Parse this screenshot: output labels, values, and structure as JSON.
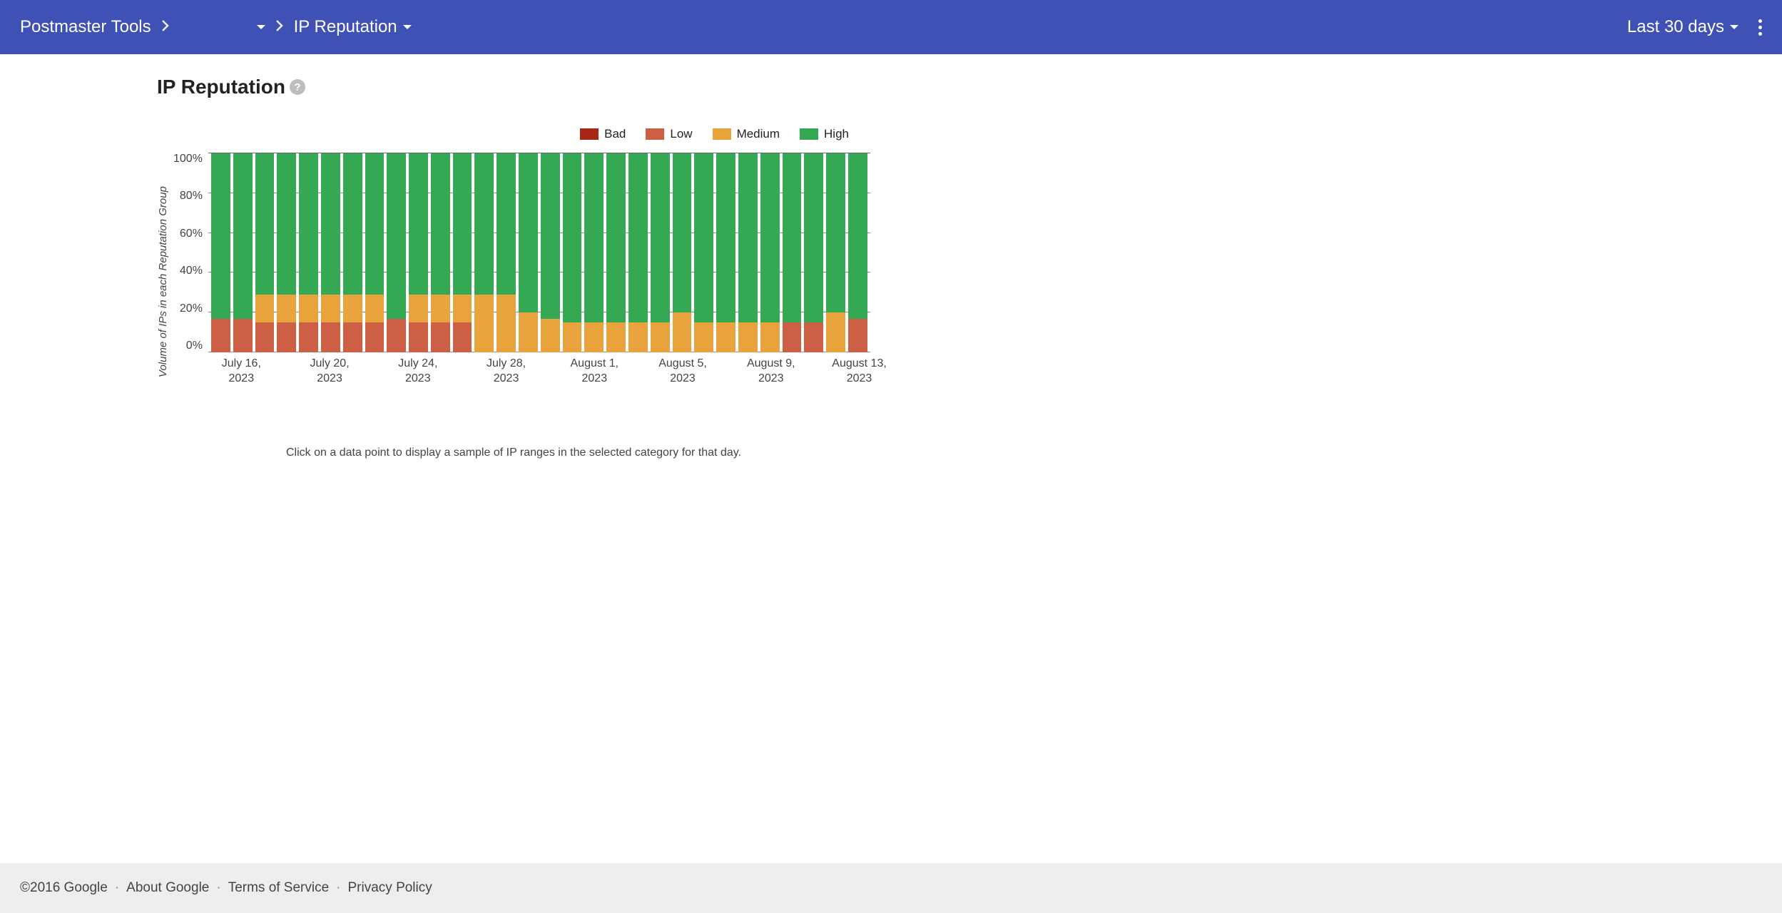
{
  "header": {
    "app_title": "Postmaster Tools",
    "domain_label": "",
    "view_label": "IP Reputation",
    "daterange_label": "Last 30 days"
  },
  "page": {
    "title": "IP Reputation",
    "help_glyph": "?"
  },
  "legend": {
    "bad": {
      "label": "Bad",
      "color": "#a52714"
    },
    "low": {
      "label": "Low",
      "color": "#cc5f44"
    },
    "medium": {
      "label": "Medium",
      "color": "#e8a33d"
    },
    "high": {
      "label": "High",
      "color": "#34a853"
    }
  },
  "chart_data": {
    "type": "stacked-bar",
    "title": "IP Reputation",
    "ylabel": "Volume of IPs in each Reputation Group",
    "xlabel": "",
    "ylim": [
      0,
      100
    ],
    "yticks": [
      "0%",
      "20%",
      "40%",
      "60%",
      "80%",
      "100%"
    ],
    "xtick_labels": [
      "July 16, 2023",
      "July 20, 2023",
      "July 24, 2023",
      "July 28, 2023",
      "August 1, 2023",
      "August 5, 2023",
      "August 9, 2023",
      "August 13, 2023"
    ],
    "xtick_indices": [
      1,
      5,
      9,
      13,
      17,
      21,
      25,
      29
    ],
    "categories": [
      "July 15, 2023",
      "July 16, 2023",
      "July 17, 2023",
      "July 18, 2023",
      "July 19, 2023",
      "July 20, 2023",
      "July 21, 2023",
      "July 22, 2023",
      "July 23, 2023",
      "July 24, 2023",
      "July 25, 2023",
      "July 26, 2023",
      "July 27, 2023",
      "July 28, 2023",
      "July 29, 2023",
      "July 30, 2023",
      "July 31, 2023",
      "August 1, 2023",
      "August 2, 2023",
      "August 3, 2023",
      "August 4, 2023",
      "August 5, 2023",
      "August 6, 2023",
      "August 7, 2023",
      "August 8, 2023",
      "August 9, 2023",
      "August 10, 2023",
      "August 11, 2023",
      "August 12, 2023",
      "August 13, 2023"
    ],
    "series": [
      {
        "name": "Bad",
        "color": "#a52714",
        "values": [
          0,
          0,
          0,
          0,
          0,
          0,
          0,
          0,
          0,
          0,
          0,
          0,
          0,
          0,
          0,
          0,
          0,
          0,
          0,
          0,
          0,
          0,
          0,
          0,
          0,
          0,
          0,
          0,
          0,
          0
        ]
      },
      {
        "name": "Low",
        "color": "#cc5f44",
        "values": [
          17,
          17,
          15,
          15,
          15,
          15,
          15,
          15,
          17,
          15,
          15,
          15,
          0,
          0,
          0,
          0,
          0,
          0,
          0,
          0,
          0,
          0,
          0,
          0,
          0,
          0,
          15,
          15,
          0,
          17
        ]
      },
      {
        "name": "Medium",
        "color": "#e8a33d",
        "values": [
          0,
          0,
          14,
          14,
          14,
          14,
          14,
          14,
          0,
          14,
          14,
          14,
          29,
          29,
          20,
          17,
          15,
          15,
          15,
          15,
          15,
          20,
          15,
          15,
          15,
          15,
          0,
          0,
          20,
          0
        ]
      },
      {
        "name": "High",
        "color": "#34a853",
        "values": [
          83,
          83,
          71,
          71,
          71,
          71,
          71,
          71,
          83,
          71,
          71,
          71,
          71,
          71,
          80,
          83,
          85,
          85,
          85,
          85,
          85,
          80,
          85,
          85,
          85,
          85,
          85,
          85,
          80,
          83
        ]
      }
    ],
    "note": "Click on a data point to display a sample of IP ranges in the selected category for that day."
  },
  "footer": {
    "copyright": "©2016 Google",
    "links": [
      "About Google",
      "Terms of Service",
      "Privacy Policy"
    ]
  }
}
